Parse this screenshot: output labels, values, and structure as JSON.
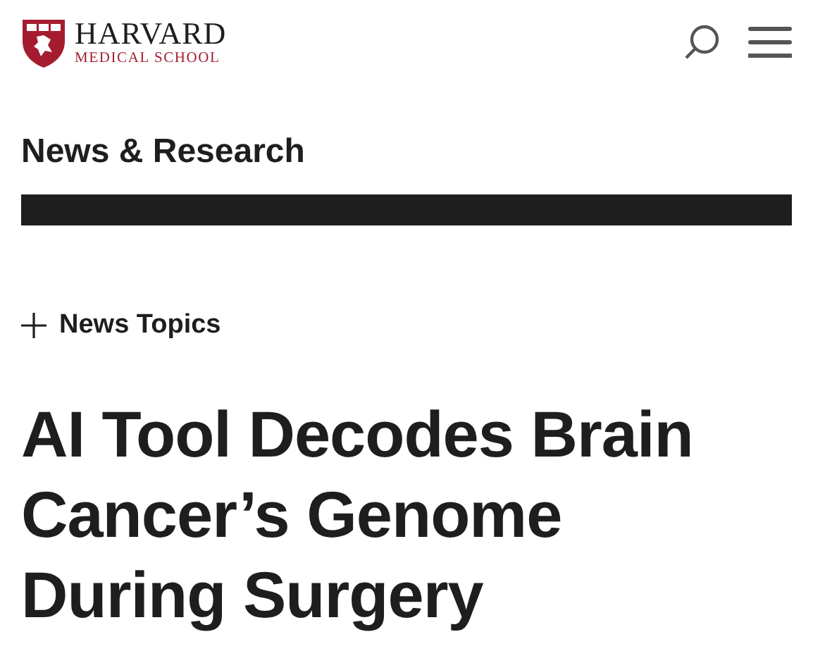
{
  "header": {
    "logo": {
      "name": "HARVARD",
      "subtitle": "MEDICAL SCHOOL"
    }
  },
  "section_title": "News & Research",
  "topics_toggle": {
    "label": "News Topics",
    "expanded": false
  },
  "headline": "AI Tool Decodes Brain Cancer’s Genome During Surgery"
}
